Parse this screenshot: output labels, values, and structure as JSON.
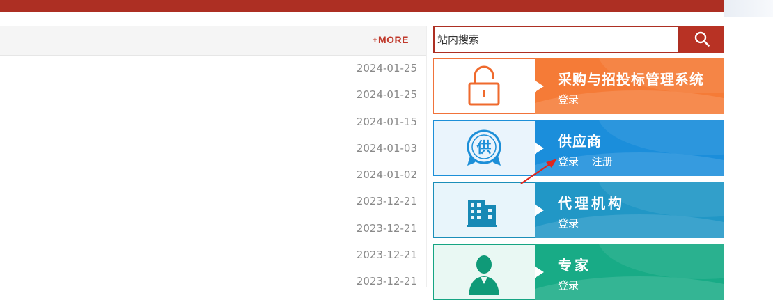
{
  "news": {
    "more_label": "+MORE",
    "items": [
      {
        "date": "2024-01-25"
      },
      {
        "date": "2024-01-25"
      },
      {
        "date": "2024-01-15"
      },
      {
        "date": "2024-01-03"
      },
      {
        "date": "2024-01-02"
      },
      {
        "date": "2023-12-21"
      },
      {
        "date": "2023-12-21"
      },
      {
        "date": "2023-12-21"
      },
      {
        "date": "2023-12-21"
      }
    ]
  },
  "search": {
    "placeholder": "站内搜索",
    "button_icon": "search-icon"
  },
  "portals": [
    {
      "title": "采购与招投标管理系统",
      "links": [
        "登录"
      ],
      "color": "#f57b37",
      "icon": "unlock-icon"
    },
    {
      "title": "供应商",
      "links": [
        "登录",
        "注册"
      ],
      "color": "#1b8edb",
      "icon": "supplier-seal-icon",
      "icon_text": "供"
    },
    {
      "title": "代理机构",
      "links": [
        "登录"
      ],
      "color": "#2197c6",
      "icon": "building-icon"
    },
    {
      "title": "专家",
      "links": [
        "登录"
      ],
      "color": "#18ab86",
      "icon": "expert-person-icon"
    }
  ],
  "theme": {
    "brand_red": "#ad2f23"
  }
}
